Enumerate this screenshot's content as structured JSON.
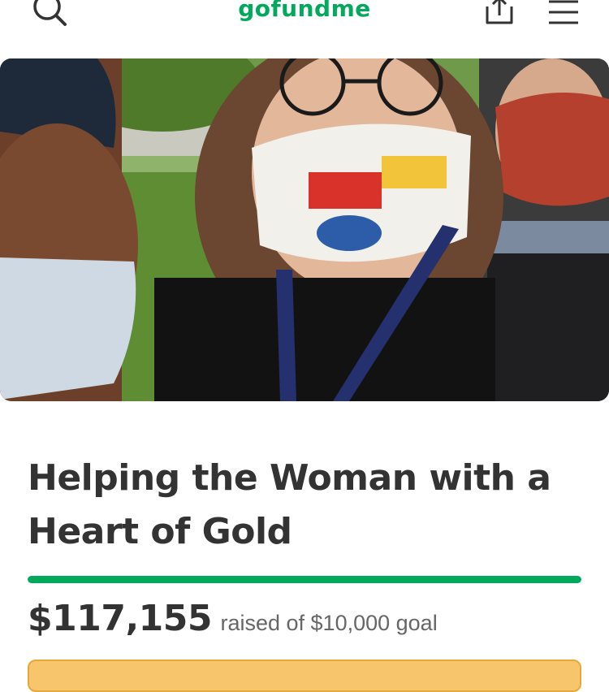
{
  "header": {
    "logo_text": "gofundme",
    "icons": [
      "search-icon",
      "share-icon",
      "menu-icon"
    ],
    "brand_color": "#02a95c"
  },
  "campaign": {
    "title": "Helping the Woman with a Heart of Gold",
    "amount_raised": "$117,155",
    "goal_text": "raised of $10,000 goal",
    "progress_fraction": 1.0
  }
}
